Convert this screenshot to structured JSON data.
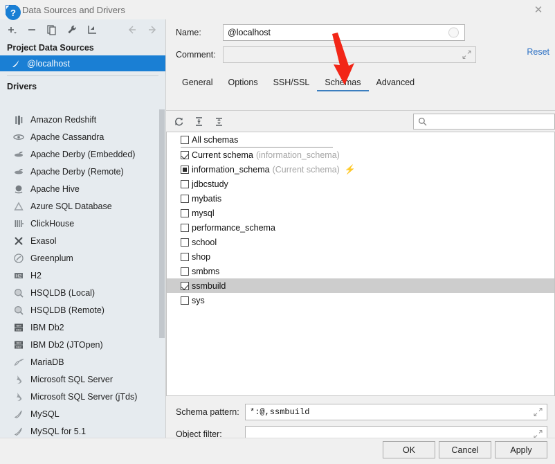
{
  "window": {
    "title": "Data Sources and Drivers",
    "logo": "intellij-idea-logo",
    "close_label": "✕"
  },
  "sidebar": {
    "toolbar": [
      {
        "name": "add-data-source-button",
        "glyph": "+"
      },
      {
        "name": "remove-data-source-button",
        "glyph": "−"
      },
      {
        "name": "duplicate-data-source-button",
        "glyph": "copy"
      },
      {
        "name": "properties-wrench-button",
        "glyph": "wrench"
      },
      {
        "name": "import-data-source-button",
        "glyph": "import"
      },
      {
        "name": "navigate-back-button",
        "glyph": "←"
      },
      {
        "name": "navigate-forward-button",
        "glyph": "→"
      }
    ],
    "project_section_title": "Project Data Sources",
    "data_sources": [
      {
        "label": "@localhost",
        "icon": "mysql-icon",
        "selected": true
      }
    ],
    "drivers_section_title": "Drivers",
    "drivers": [
      {
        "label": "Amazon Redshift",
        "icon": "redshift-icon"
      },
      {
        "label": "Apache Cassandra",
        "icon": "cassandra-icon"
      },
      {
        "label": "Apache Derby (Embedded)",
        "icon": "derby-icon"
      },
      {
        "label": "Apache Derby (Remote)",
        "icon": "derby-icon"
      },
      {
        "label": "Apache Hive",
        "icon": "hive-icon"
      },
      {
        "label": "Azure SQL Database",
        "icon": "azure-icon"
      },
      {
        "label": "ClickHouse",
        "icon": "clickhouse-icon"
      },
      {
        "label": "Exasol",
        "icon": "exasol-icon"
      },
      {
        "label": "Greenplum",
        "icon": "greenplum-icon"
      },
      {
        "label": "H2",
        "icon": "h2-icon"
      },
      {
        "label": "HSQLDB (Local)",
        "icon": "hsqldb-icon"
      },
      {
        "label": "HSQLDB (Remote)",
        "icon": "hsqldb-icon"
      },
      {
        "label": "IBM Db2",
        "icon": "db2-icon"
      },
      {
        "label": "IBM Db2 (JTOpen)",
        "icon": "db2-icon"
      },
      {
        "label": "MariaDB",
        "icon": "mariadb-icon"
      },
      {
        "label": "Microsoft SQL Server",
        "icon": "mssql-icon"
      },
      {
        "label": "Microsoft SQL Server (jTds)",
        "icon": "mssql-icon"
      },
      {
        "label": "MySQL",
        "icon": "mysql-icon"
      },
      {
        "label": "MySQL for 5.1",
        "icon": "mysql-icon"
      }
    ]
  },
  "details": {
    "name_label": "Name:",
    "name_value": "@localhost",
    "comment_label": "Comment:",
    "comment_value": "",
    "reset_label": "Reset",
    "tabs": [
      {
        "label": "General",
        "active": false
      },
      {
        "label": "Options",
        "active": false
      },
      {
        "label": "SSH/SSL",
        "active": false
      },
      {
        "label": "Schemas",
        "active": true
      },
      {
        "label": "Advanced",
        "active": false
      }
    ]
  },
  "schemas_panel": {
    "toolbar": [
      {
        "name": "refresh-schemas-icon"
      },
      {
        "name": "expand-all-icon"
      },
      {
        "name": "collapse-all-icon"
      }
    ],
    "search_placeholder": "",
    "search_value": "",
    "rows": [
      {
        "label": "All schemas",
        "note": "",
        "state": "unchecked",
        "highlight": false,
        "separator_after": true,
        "bolt": false
      },
      {
        "label": "Current schema",
        "note": "(information_schema)",
        "state": "checked",
        "highlight": false,
        "separator_after": false,
        "bolt": false
      },
      {
        "label": "information_schema",
        "note": "(Current schema)",
        "state": "filled",
        "highlight": false,
        "separator_after": false,
        "bolt": true
      },
      {
        "label": "jdbcstudy",
        "note": "",
        "state": "unchecked",
        "highlight": false,
        "separator_after": false,
        "bolt": false
      },
      {
        "label": "mybatis",
        "note": "",
        "state": "unchecked",
        "highlight": false,
        "separator_after": false,
        "bolt": false
      },
      {
        "label": "mysql",
        "note": "",
        "state": "unchecked",
        "highlight": false,
        "separator_after": false,
        "bolt": false
      },
      {
        "label": "performance_schema",
        "note": "",
        "state": "unchecked",
        "highlight": false,
        "separator_after": false,
        "bolt": false
      },
      {
        "label": "school",
        "note": "",
        "state": "unchecked",
        "highlight": false,
        "separator_after": false,
        "bolt": false
      },
      {
        "label": "shop",
        "note": "",
        "state": "unchecked",
        "highlight": false,
        "separator_after": false,
        "bolt": false
      },
      {
        "label": "smbms",
        "note": "",
        "state": "unchecked",
        "highlight": false,
        "separator_after": false,
        "bolt": false
      },
      {
        "label": "ssmbuild",
        "note": "",
        "state": "checked",
        "highlight": true,
        "separator_after": false,
        "bolt": false
      },
      {
        "label": "sys",
        "note": "",
        "state": "unchecked",
        "highlight": false,
        "separator_after": false,
        "bolt": false
      }
    ],
    "schema_pattern_label": "Schema pattern:",
    "schema_pattern_value": "*:@,ssmbuild",
    "object_filter_label": "Object filter:",
    "object_filter_value": ""
  },
  "footer": {
    "help_label": "?",
    "ok_label": "OK",
    "cancel_label": "Cancel",
    "apply_label": "Apply"
  },
  "annotation": {
    "arrow_color": "#f22617",
    "points_to": "Schemas tab"
  }
}
